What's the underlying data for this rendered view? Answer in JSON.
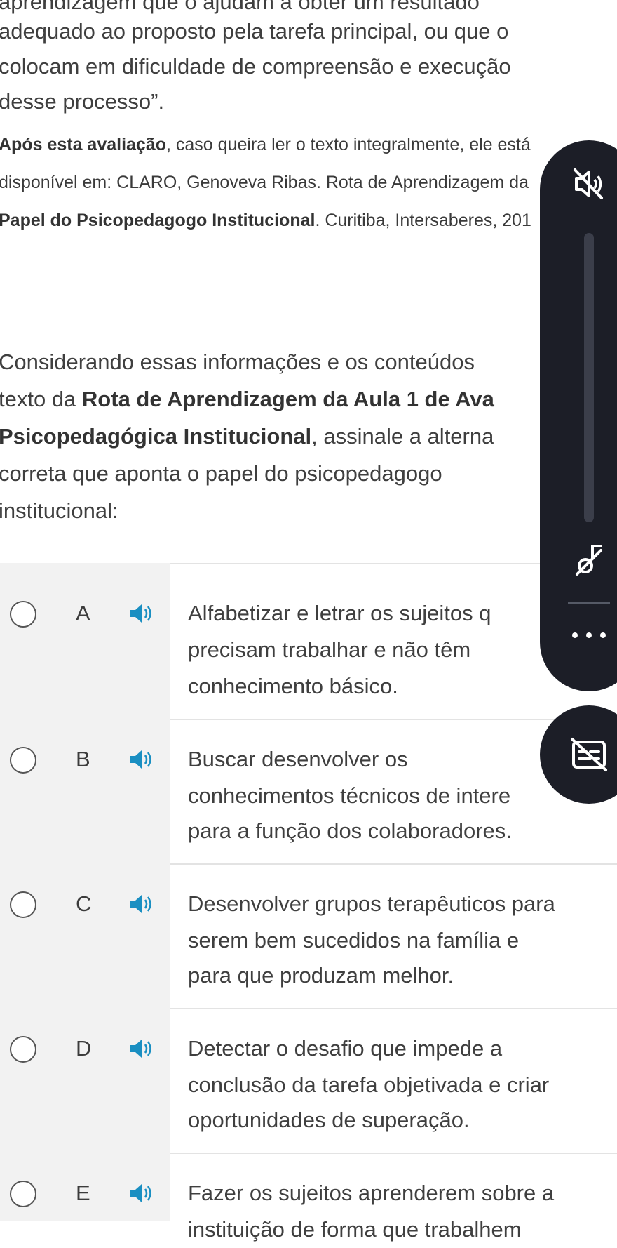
{
  "question": {
    "partial_top_line": "aprendizagem que o ajudam a obter um resultado",
    "line1": "adequado ao proposto pela tarefa principal, ou que o",
    "line2": "colocam em dificuldade de compreensão e execução",
    "line3": "desse processo”.",
    "source_line1_bold": "Após esta avaliação",
    "source_line1_rest": ", caso queira ler o texto integralmente, ele está",
    "source_line2": "disponível em: CLARO, Genoveva Ribas. Rota de Aprendizagem da",
    "source_line3_bold": "Papel do Psicopedagogo Institucional",
    "source_line3_rest": ". Curitiba, Intersaberes, 201",
    "prompt_line1": "Considerando essas informações e os conteúdos",
    "prompt_line2_start": "texto da ",
    "prompt_line2_bold": "Rota de Aprendizagem da Aula 1 de Ava",
    "prompt_line3_bold": "Psicopedagógica Institucional",
    "prompt_line3_rest": ", assinale a alterna",
    "prompt_line4": "correta que aponta o papel do psicopedagogo",
    "prompt_line5": "institucional:"
  },
  "options": [
    {
      "letter": "A",
      "lines": [
        "Alfabetizar e letrar os sujeitos q",
        "precisam trabalhar e não têm",
        "conhecimento básico."
      ]
    },
    {
      "letter": "B",
      "lines": [
        "Buscar desenvolver os",
        "conhecimentos técnicos de intere",
        "para a função dos colaboradores."
      ]
    },
    {
      "letter": "C",
      "lines": [
        "Desenvolver grupos terapêuticos para",
        "serem bem sucedidos na família e",
        "para que produzam melhor."
      ]
    },
    {
      "letter": "D",
      "lines": [
        "Detectar o desafio que impede a",
        "conclusão da tarefa objetivada e criar",
        "oportunidades de superação."
      ]
    },
    {
      "letter": "E",
      "lines": [
        "Fazer os sujeitos aprenderem sobre a",
        "instituição de forma que trabalhem"
      ]
    }
  ],
  "volume_panel": {
    "icons": [
      "speaker-muted-icon",
      "equalizer-icon",
      "more-options-icon",
      "captions-icon"
    ],
    "volume_level": 0
  },
  "colors": {
    "speaker_blue": "#1a8fc2",
    "panel_bg": "#1c1e27",
    "option_left_bg": "#f2f2f2"
  }
}
